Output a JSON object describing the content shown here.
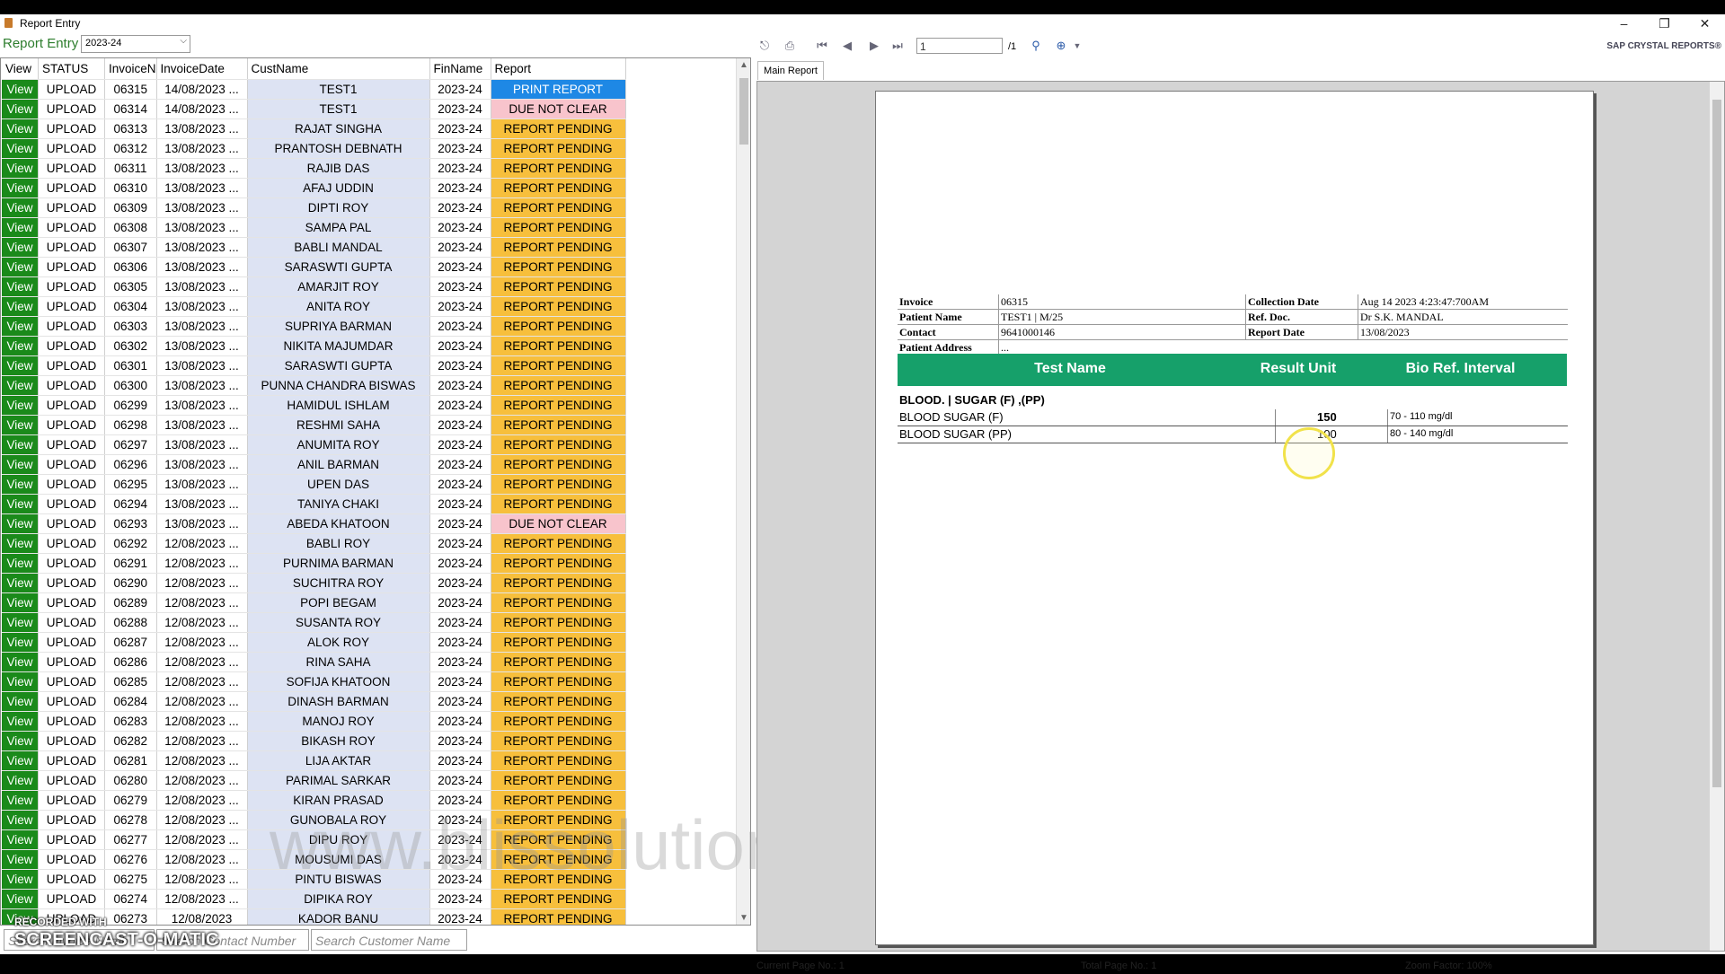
{
  "window": {
    "title": "Report Entry",
    "min": "–",
    "max": "❐",
    "close": "✕"
  },
  "left": {
    "label": "Report Entry",
    "year": "2023-24",
    "headers": [
      "View",
      "STATUS",
      "InvoiceN",
      "InvoiceDate",
      "CustName",
      "FinName",
      "Report"
    ],
    "rows": [
      [
        "View",
        "UPLOAD",
        "06315",
        "14/08/2023 ...",
        "TEST1",
        "2023-24",
        "PRINT REPORT"
      ],
      [
        "View",
        "UPLOAD",
        "06314",
        "14/08/2023 ...",
        "TEST1",
        "2023-24",
        "DUE NOT CLEAR"
      ],
      [
        "View",
        "UPLOAD",
        "06313",
        "13/08/2023 ...",
        "RAJAT  SINGHA",
        "2023-24",
        "REPORT PENDING"
      ],
      [
        "View",
        "UPLOAD",
        "06312",
        "13/08/2023 ...",
        "PRANTOSH DEBNATH",
        "2023-24",
        "REPORT PENDING"
      ],
      [
        "View",
        "UPLOAD",
        "06311",
        "13/08/2023 ...",
        "RAJIB DAS",
        "2023-24",
        "REPORT PENDING"
      ],
      [
        "View",
        "UPLOAD",
        "06310",
        "13/08/2023 ...",
        "AFAJ UDDIN",
        "2023-24",
        "REPORT PENDING"
      ],
      [
        "View",
        "UPLOAD",
        "06309",
        "13/08/2023 ...",
        "DIPTI ROY",
        "2023-24",
        "REPORT PENDING"
      ],
      [
        "View",
        "UPLOAD",
        "06308",
        "13/08/2023 ...",
        "SAMPA PAL",
        "2023-24",
        "REPORT PENDING"
      ],
      [
        "View",
        "UPLOAD",
        "06307",
        "13/08/2023 ...",
        "BABLI MANDAL",
        "2023-24",
        "REPORT PENDING"
      ],
      [
        "View",
        "UPLOAD",
        "06306",
        "13/08/2023 ...",
        "SARASWTI   GUPTA",
        "2023-24",
        "REPORT PENDING"
      ],
      [
        "View",
        "UPLOAD",
        "06305",
        "13/08/2023 ...",
        "AMARJIT ROY",
        "2023-24",
        "REPORT PENDING"
      ],
      [
        "View",
        "UPLOAD",
        "06304",
        "13/08/2023 ...",
        "ANITA ROY",
        "2023-24",
        "REPORT PENDING"
      ],
      [
        "View",
        "UPLOAD",
        "06303",
        "13/08/2023 ...",
        "SUPRIYA BARMAN",
        "2023-24",
        "REPORT PENDING"
      ],
      [
        "View",
        "UPLOAD",
        "06302",
        "13/08/2023 ...",
        "NIKITA MAJUMDAR",
        "2023-24",
        "REPORT PENDING"
      ],
      [
        "View",
        "UPLOAD",
        "06301",
        "13/08/2023 ...",
        "SARASWTI   GUPTA",
        "2023-24",
        "REPORT PENDING"
      ],
      [
        "View",
        "UPLOAD",
        "06300",
        "13/08/2023 ...",
        "PUNNA CHANDRA BISWAS",
        "2023-24",
        "REPORT PENDING"
      ],
      [
        "View",
        "UPLOAD",
        "06299",
        "13/08/2023 ...",
        "HAMIDUL ISHLAM",
        "2023-24",
        "REPORT PENDING"
      ],
      [
        "View",
        "UPLOAD",
        "06298",
        "13/08/2023 ...",
        "RESHMI SAHA",
        "2023-24",
        "REPORT PENDING"
      ],
      [
        "View",
        "UPLOAD",
        "06297",
        "13/08/2023 ...",
        "ANUMITA ROY",
        "2023-24",
        "REPORT PENDING"
      ],
      [
        "View",
        "UPLOAD",
        "06296",
        "13/08/2023 ...",
        "ANIL  BARMAN",
        "2023-24",
        "REPORT PENDING"
      ],
      [
        "View",
        "UPLOAD",
        "06295",
        "13/08/2023 ...",
        "UPEN DAS",
        "2023-24",
        "REPORT PENDING"
      ],
      [
        "View",
        "UPLOAD",
        "06294",
        "13/08/2023 ...",
        "TANIYA CHAKI",
        "2023-24",
        "REPORT PENDING"
      ],
      [
        "View",
        "UPLOAD",
        "06293",
        "13/08/2023 ...",
        "ABEDA KHATOON",
        "2023-24",
        "DUE NOT CLEAR"
      ],
      [
        "View",
        "UPLOAD",
        "06292",
        "12/08/2023 ...",
        "BABLI ROY",
        "2023-24",
        "REPORT PENDING"
      ],
      [
        "View",
        "UPLOAD",
        "06291",
        "12/08/2023 ...",
        "PURNIMA BARMAN",
        "2023-24",
        "REPORT PENDING"
      ],
      [
        "View",
        "UPLOAD",
        "06290",
        "12/08/2023 ...",
        "SUCHITRA ROY",
        "2023-24",
        "REPORT PENDING"
      ],
      [
        "View",
        "UPLOAD",
        "06289",
        "12/08/2023 ...",
        "POPI  BEGAM",
        "2023-24",
        "REPORT PENDING"
      ],
      [
        "View",
        "UPLOAD",
        "06288",
        "12/08/2023 ...",
        "SUSANTA ROY",
        "2023-24",
        "REPORT PENDING"
      ],
      [
        "View",
        "UPLOAD",
        "06287",
        "12/08/2023 ...",
        "ALOK  ROY",
        "2023-24",
        "REPORT PENDING"
      ],
      [
        "View",
        "UPLOAD",
        "06286",
        "12/08/2023 ...",
        "RINA SAHA",
        "2023-24",
        "REPORT PENDING"
      ],
      [
        "View",
        "UPLOAD",
        "06285",
        "12/08/2023 ...",
        "SOFIJA KHATOON",
        "2023-24",
        "REPORT PENDING"
      ],
      [
        "View",
        "UPLOAD",
        "06284",
        "12/08/2023 ...",
        "DINASH  BARMAN",
        "2023-24",
        "REPORT PENDING"
      ],
      [
        "View",
        "UPLOAD",
        "06283",
        "12/08/2023 ...",
        "MANOJ ROY",
        "2023-24",
        "REPORT PENDING"
      ],
      [
        "View",
        "UPLOAD",
        "06282",
        "12/08/2023 ...",
        "BIKASH ROY",
        "2023-24",
        "REPORT PENDING"
      ],
      [
        "View",
        "UPLOAD",
        "06281",
        "12/08/2023 ...",
        "LIJA AKTAR",
        "2023-24",
        "REPORT PENDING"
      ],
      [
        "View",
        "UPLOAD",
        "06280",
        "12/08/2023 ...",
        "PARIMAL  SARKAR",
        "2023-24",
        "REPORT PENDING"
      ],
      [
        "View",
        "UPLOAD",
        "06279",
        "12/08/2023 ...",
        "KIRAN PRASAD",
        "2023-24",
        "REPORT PENDING"
      ],
      [
        "View",
        "UPLOAD",
        "06278",
        "12/08/2023 ...",
        "GUNOBALA ROY",
        "2023-24",
        "REPORT PENDING"
      ],
      [
        "View",
        "UPLOAD",
        "06277",
        "12/08/2023 ...",
        "DIPU ROY",
        "2023-24",
        "REPORT PENDING"
      ],
      [
        "View",
        "UPLOAD",
        "06276",
        "12/08/2023 ...",
        "MOUSUMI DAS",
        "2023-24",
        "REPORT PENDING"
      ],
      [
        "View",
        "UPLOAD",
        "06275",
        "12/08/2023 ...",
        "PINTU BISWAS",
        "2023-24",
        "REPORT PENDING"
      ],
      [
        "View",
        "UPLOAD",
        "06274",
        "12/08/2023 ...",
        "DIPIKA ROY",
        "2023-24",
        "REPORT PENDING"
      ],
      [
        "View",
        "UPLOAD",
        "06273",
        "12/08/2023",
        "KADOR BANU",
        "2023-24",
        "REPORT PENDING"
      ]
    ],
    "search": {
      "invoice_placeholder": "Search Invoice Numb",
      "contact_placeholder": "Search Contact Number",
      "customer_placeholder": "Search Customer Name"
    }
  },
  "overlay": {
    "watermark": "www.blissolutions.in",
    "recorded": "RECORDED WITH",
    "brand": "SCREENCAST-O-MATIC"
  },
  "viewer": {
    "page_input": "1",
    "page_total": "/1",
    "brand": "SAP CRYSTAL REPORTS®",
    "tab": "Main Report",
    "status_current": "Current Page No.: 1",
    "status_total": "Total Page No.: 1",
    "status_zoom": "Zoom Factor: 100%"
  },
  "report": {
    "invoice_label": "Invoice",
    "invoice": "06315",
    "collection_label": "Collection Date",
    "collection": "Aug 14 2023  4:23:47:700AM",
    "patient_label": "Patient Name",
    "patient": "TEST1 | M/25",
    "refdoc_label": "Ref. Doc.",
    "refdoc": "Dr S.K. MANDAL",
    "contact_label": "Contact",
    "contact": "9641000146",
    "reportdate_label": "Report Date",
    "reportdate": "13/08/2023",
    "address_label": "Patient Address",
    "address": "...",
    "col_test": "Test Name",
    "col_result": "Result Unit",
    "col_ref": "Bio Ref. Interval",
    "group": "BLOOD. | SUGAR (F) ,(PP)",
    "tests": [
      {
        "name": "BLOOD SUGAR (F)",
        "result": "150",
        "ref": "70 - 110 mg/dl"
      },
      {
        "name": "BLOOD SUGAR (PP)",
        "result": "100",
        "ref": "80 - 140 mg/dl"
      }
    ]
  }
}
